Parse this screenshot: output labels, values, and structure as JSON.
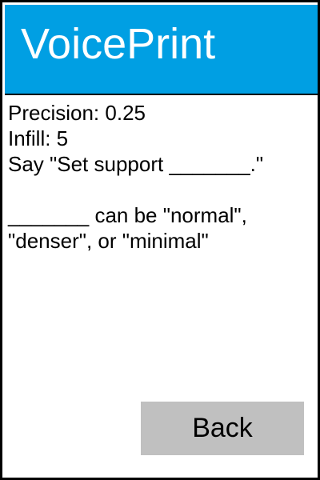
{
  "colors": {
    "header_bg": "#009fe3",
    "header_text": "#ffffff",
    "button_bg": "#c0c0c0"
  },
  "header": {
    "title": "VoicePrint"
  },
  "settings": {
    "precision": "Precision: 0.25",
    "infill": "Infill: 5"
  },
  "instructions": {
    "command": "Say \"Set support _______.\"",
    "options_line1": "_______ can be \"normal\",",
    "options_line2": "\"denser\", or \"minimal\""
  },
  "buttons": {
    "back_label": "Back"
  }
}
